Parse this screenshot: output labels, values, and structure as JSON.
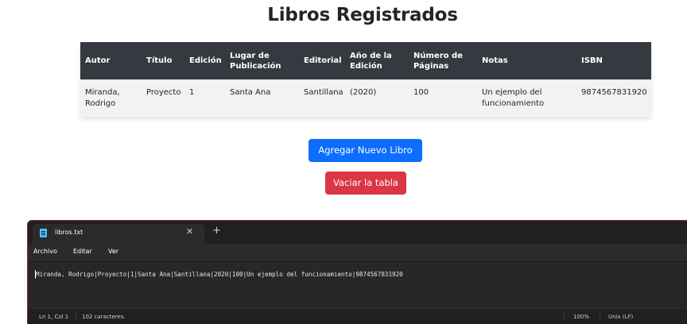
{
  "page": {
    "title": "Libros Registrados"
  },
  "table": {
    "headers": [
      "Autor",
      "Título",
      "Edición",
      "Lugar de\nPublicación",
      "Editorial",
      "Año de la\nEdición",
      "Número de\nPáginas",
      "Notas",
      "ISBN"
    ],
    "rows": [
      [
        "Miranda,\nRodrigo",
        "Proyecto",
        "1",
        "Santa Ana",
        "Santillana",
        "(2020)",
        "100",
        "Un ejemplo del\nfuncionamiento",
        "9874567831920"
      ]
    ]
  },
  "buttons": {
    "add_label": "Agregar Nuevo Libro",
    "clear_label": "Vaciar la tabla"
  },
  "notepad": {
    "tab_title": "libros.txt",
    "close_glyph": "✕",
    "new_tab_glyph": "+",
    "menu": [
      "Archivo",
      "Editar",
      "Ver"
    ],
    "content": "Miranda, Rodrigo|Proyecto|1|Santa Ana|Santillana|2020|100|Un ejemplo del funcionamiento|9874567831920",
    "status": {
      "position": "Ln 1, Col 1",
      "chars": "102 caracteres.",
      "zoom": "100%",
      "line_ending": "Unix (LF)"
    }
  },
  "colors": {
    "table_header_bg": "#343a40",
    "primary": "#0d6efd",
    "danger": "#dc3545",
    "notepad_bg": "#272727"
  }
}
